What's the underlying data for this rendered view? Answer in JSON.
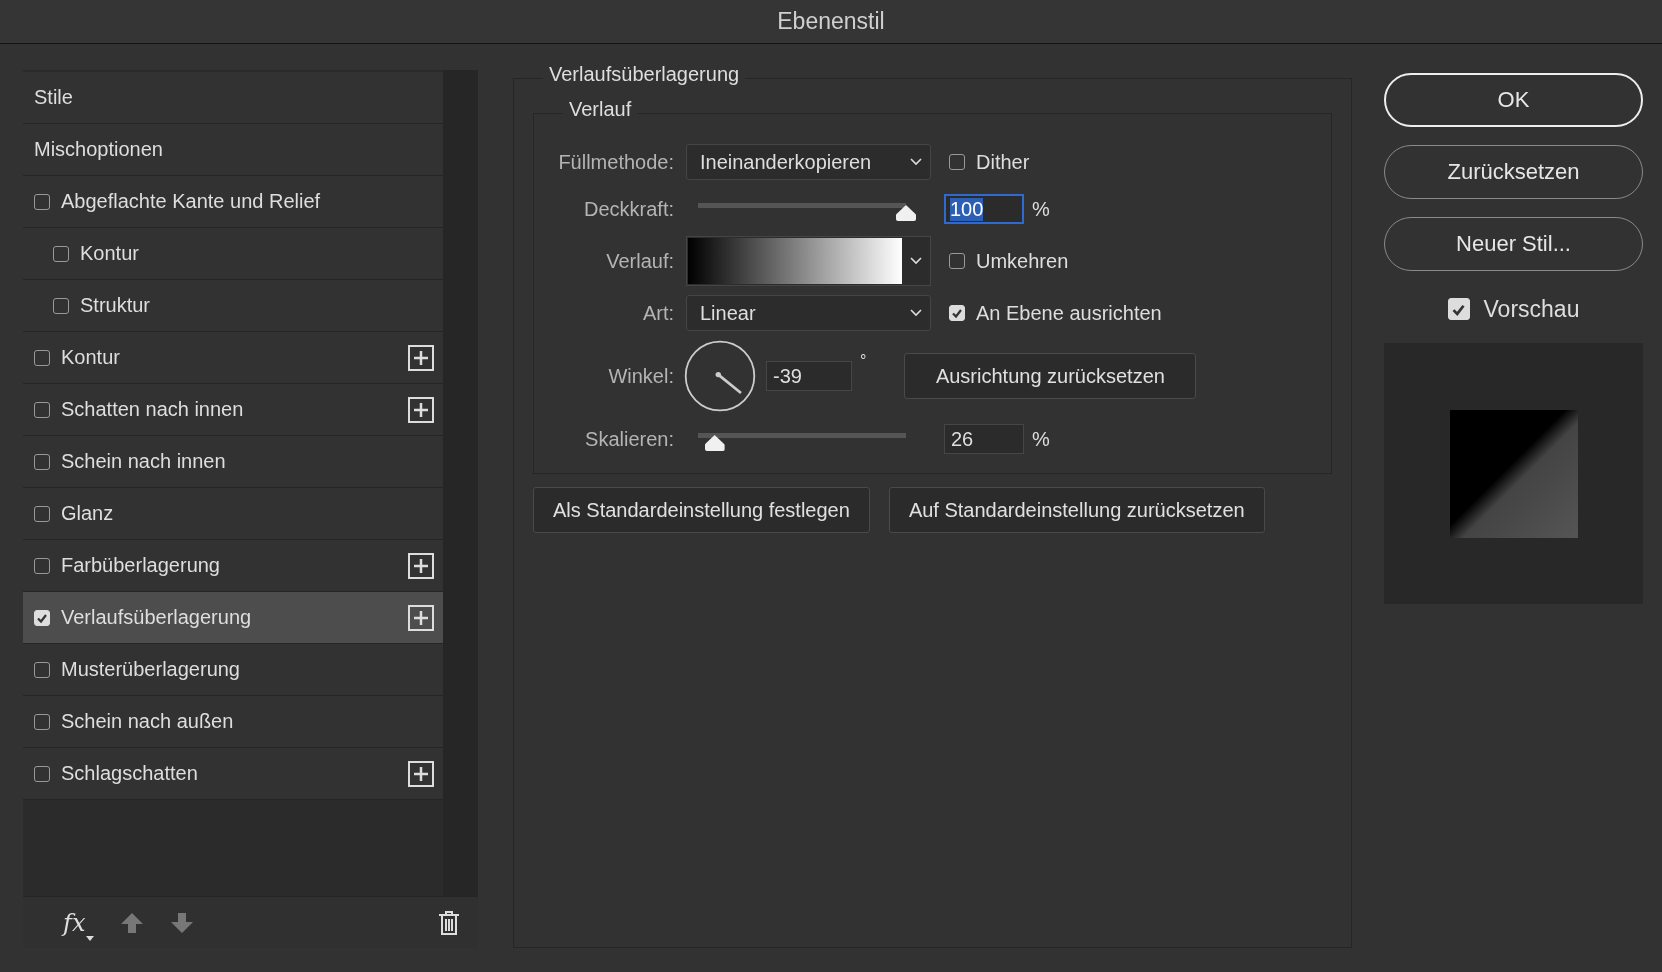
{
  "window": {
    "title": "Ebenenstil"
  },
  "styles": [
    {
      "label": "Stile",
      "kind": "header",
      "selected": false
    },
    {
      "label": "Mischoptionen",
      "kind": "header",
      "selected": false
    },
    {
      "label": "Abgeflachte Kante und Relief",
      "kind": "effect",
      "checked": false,
      "selected": false,
      "add": false,
      "children": [
        {
          "label": "Kontur",
          "kind": "effect",
          "checked": false,
          "selected": false,
          "add": false
        },
        {
          "label": "Struktur",
          "kind": "effect",
          "checked": false,
          "selected": false,
          "add": false
        }
      ]
    },
    {
      "label": "Kontur",
      "kind": "effect",
      "checked": false,
      "selected": false,
      "add": true
    },
    {
      "label": "Schatten nach innen",
      "kind": "effect",
      "checked": false,
      "selected": false,
      "add": true
    },
    {
      "label": "Schein nach innen",
      "kind": "effect",
      "checked": false,
      "selected": false,
      "add": false
    },
    {
      "label": "Glanz",
      "kind": "effect",
      "checked": false,
      "selected": false,
      "add": false
    },
    {
      "label": "Farbüberlagerung",
      "kind": "effect",
      "checked": false,
      "selected": false,
      "add": true
    },
    {
      "label": "Verlaufsüberlagerung",
      "kind": "effect",
      "checked": true,
      "selected": true,
      "add": true
    },
    {
      "label": "Musterüberlagerung",
      "kind": "effect",
      "checked": false,
      "selected": false,
      "add": false
    },
    {
      "label": "Schein nach außen",
      "kind": "effect",
      "checked": false,
      "selected": false,
      "add": false
    },
    {
      "label": "Schlagschatten",
      "kind": "effect",
      "checked": false,
      "selected": false,
      "add": true
    }
  ],
  "style_toolbar": {
    "fx_label": "fx"
  },
  "settings": {
    "title": "Verlaufsüberlagerung",
    "group_title": "Verlauf",
    "blend_mode": {
      "label": "Füllmethode:",
      "value": "Ineinanderkopieren"
    },
    "dither": {
      "label": "Dither",
      "checked": false
    },
    "opacity": {
      "label": "Deckkraft:",
      "level": 1,
      "value": "100",
      "unit": "%"
    },
    "gradient": {
      "label": "Verlauf:"
    },
    "reverse": {
      "label": "Umkehren",
      "checked": false
    },
    "style": {
      "label": "Art:",
      "value": "Linear"
    },
    "align": {
      "label": "An Ebene ausrichten",
      "checked": true
    },
    "angle": {
      "label": "Winkel:",
      "value": "-39",
      "unit": "°"
    },
    "reset_alignment": "Ausrichtung zurücksetzen",
    "scale": {
      "label": "Skalieren:",
      "level": 0.08,
      "value": "26",
      "unit": "%"
    },
    "buttons": [
      "Als Standardeinstellung festlegen",
      "Auf Standardeinstellung zurücksetzen"
    ]
  },
  "actions": [
    {
      "label": "OK",
      "kind": "default"
    },
    {
      "label": "Zurücksetzen",
      "kind": "normal"
    },
    {
      "label": "Neuer Stil...",
      "kind": "normal"
    }
  ],
  "preview": {
    "label": "Vorschau",
    "checked": true
  }
}
